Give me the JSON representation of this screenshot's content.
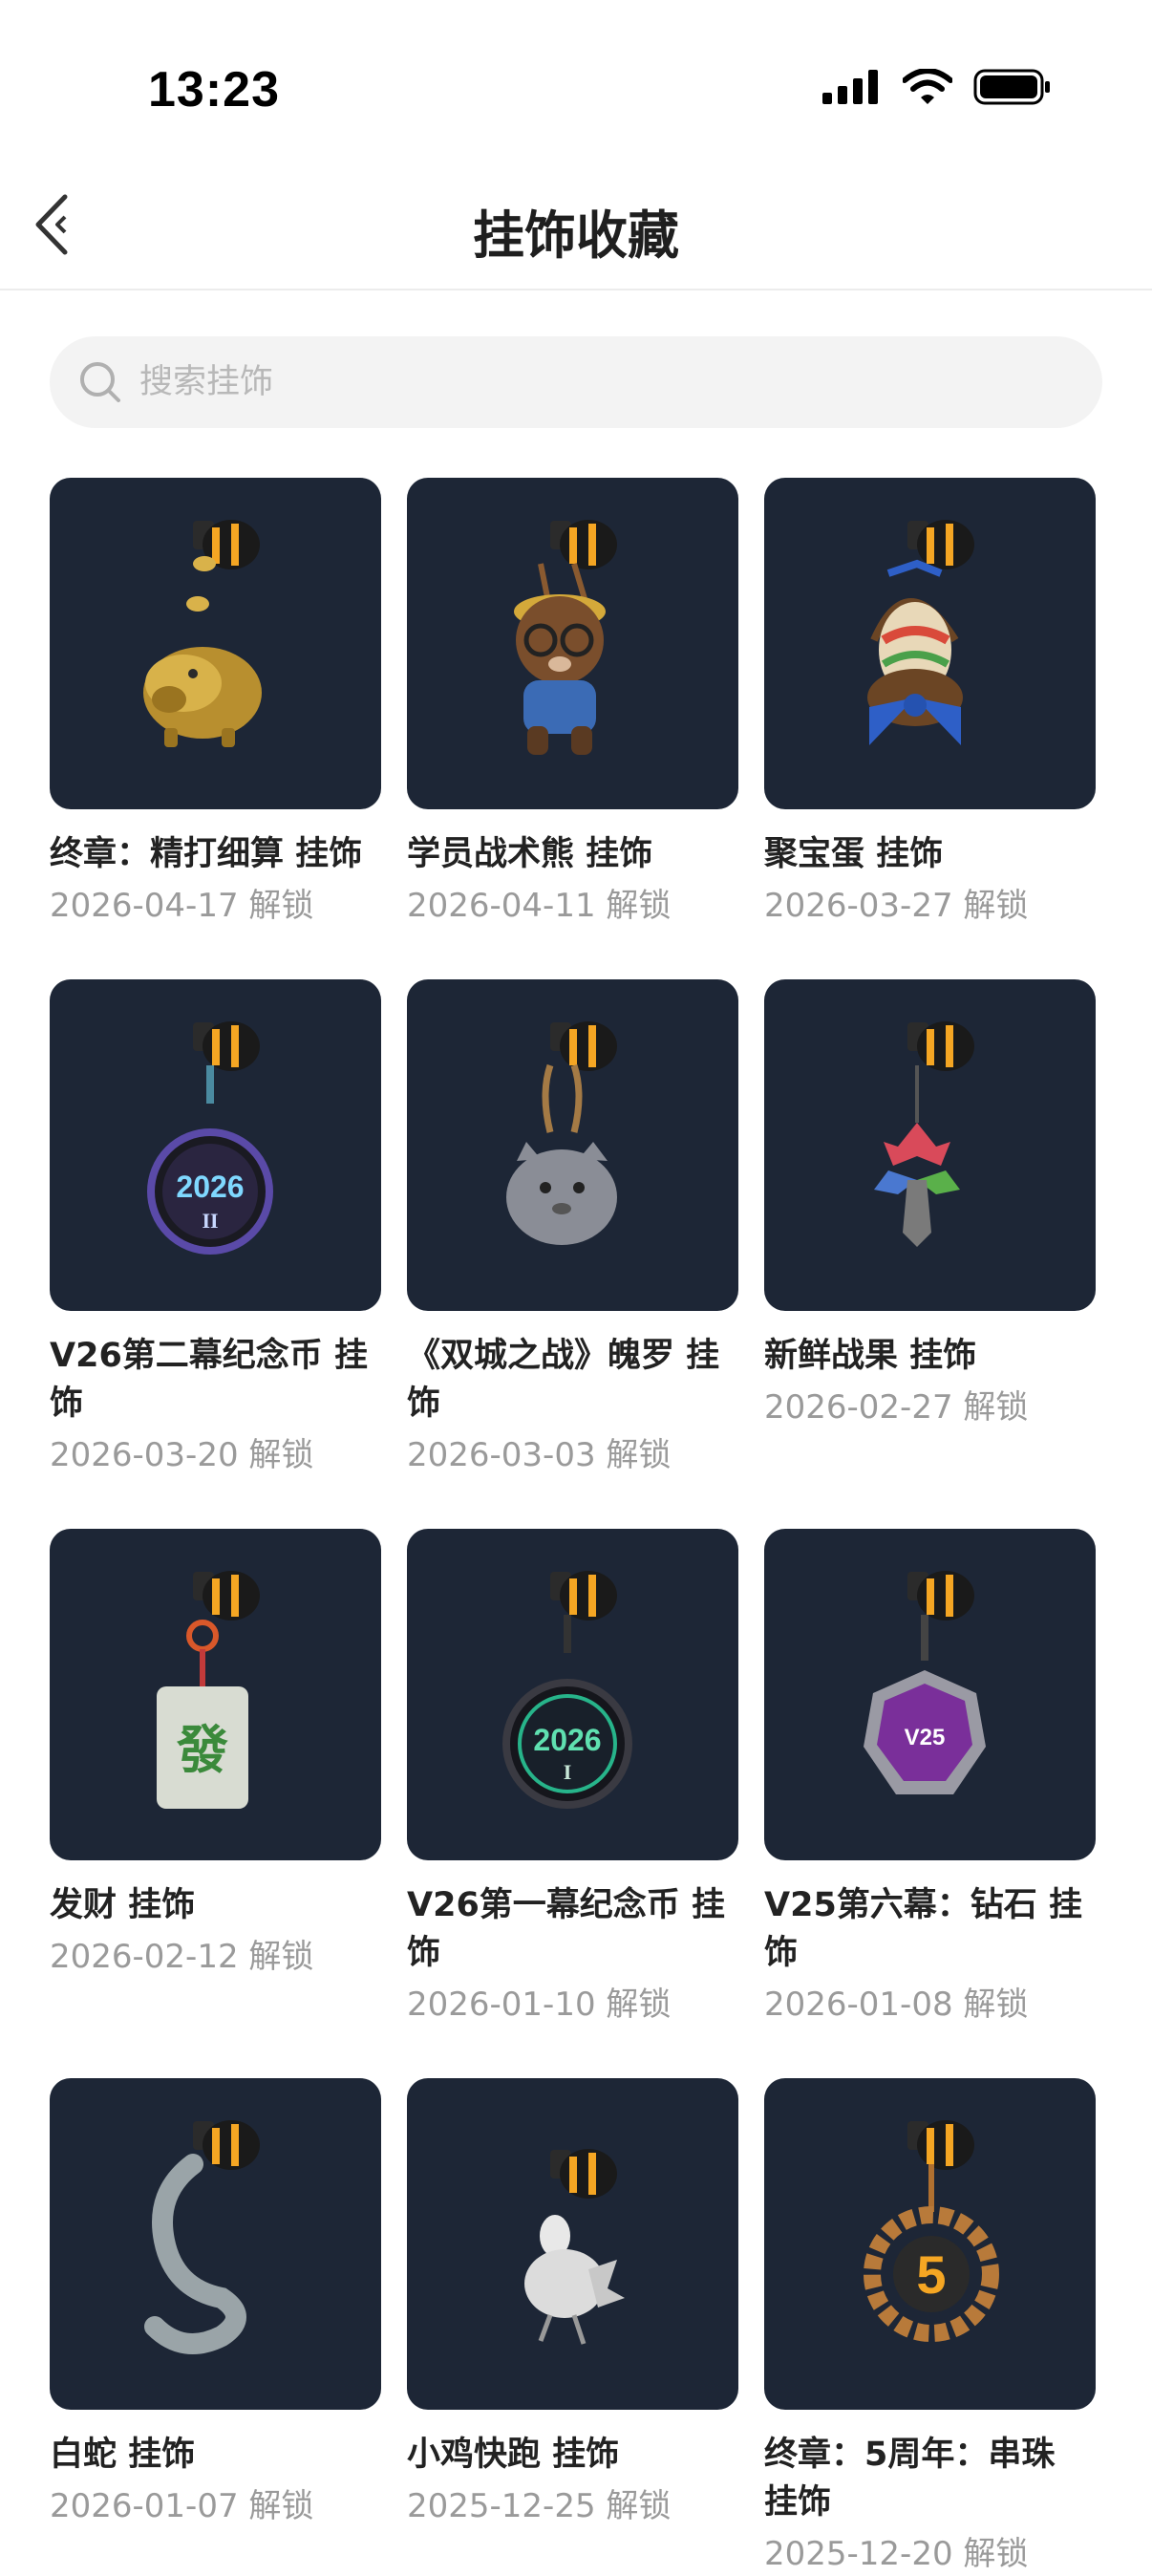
{
  "status_bar": {
    "time": "13:23"
  },
  "nav": {
    "title": "挂饰收藏"
  },
  "search": {
    "placeholder": "搜索挂饰"
  },
  "charms": [
    {
      "name": "终章：精打细算 挂饰",
      "date": "2026-04-17 解锁",
      "icon": "golden-piggy-bank-icon"
    },
    {
      "name": "学员战术熊 挂饰",
      "date": "2026-04-11 解锁",
      "icon": "tactical-bear-icon"
    },
    {
      "name": "聚宝蛋 挂饰",
      "date": "2026-03-27 解锁",
      "icon": "easter-egg-basket-icon"
    },
    {
      "name": "V26第二幕纪念币 挂饰",
      "date": "2026-03-20 解锁",
      "icon": "coin-2026-ii-icon"
    },
    {
      "name": "《双城之战》魄罗 挂饰",
      "date": "2026-03-03 解锁",
      "icon": "poro-icon"
    },
    {
      "name": "新鲜战果 挂饰",
      "date": "2026-02-27 解锁",
      "icon": "colorful-leaf-icon"
    },
    {
      "name": "发财 挂饰",
      "date": "2026-02-12 解锁",
      "icon": "mahjong-tile-icon"
    },
    {
      "name": "V26第一幕纪念币 挂饰",
      "date": "2026-01-10 解锁",
      "icon": "coin-2026-i-icon"
    },
    {
      "name": "V25第六幕：钻石 挂饰",
      "date": "2026-01-08 解锁",
      "icon": "diamond-badge-v25-icon"
    },
    {
      "name": "白蛇 挂饰",
      "date": "2026-01-07 解锁",
      "icon": "white-snake-icon"
    },
    {
      "name": "小鸡快跑 挂饰",
      "date": "2025-12-25 解锁",
      "icon": "running-chicken-icon"
    },
    {
      "name": "终章：5周年：串珠 挂饰",
      "date": "2025-12-20 解锁",
      "icon": "beaded-5-anniversary-icon"
    }
  ],
  "thumbnail_text": {
    "coin_2026_ii": "2026",
    "coin_2026_ii_sub": "II",
    "coin_2026_i": "2026",
    "coin_2026_i_sub": "I",
    "mahjong": "發",
    "v25": "V25",
    "five": "5"
  },
  "colors": {
    "thumb_bg": "#1d2636",
    "accent_orange": "#f5a623",
    "secondary_text": "#9a9a9a"
  }
}
